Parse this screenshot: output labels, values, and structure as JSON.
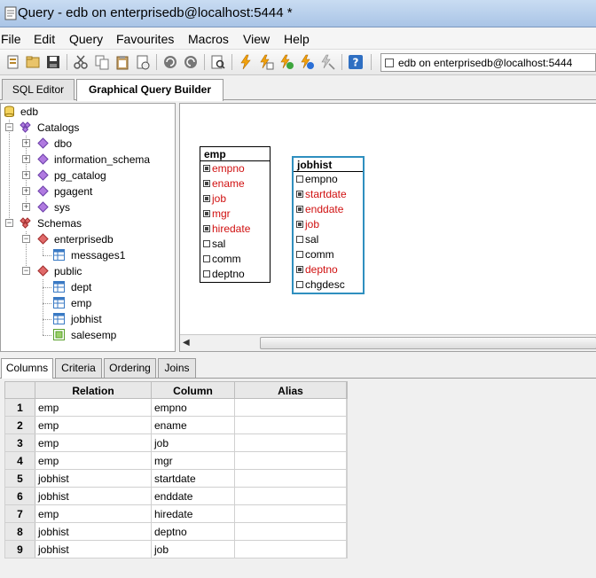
{
  "window": {
    "title": "Query - edb on enterprisedb@localhost:5444 *"
  },
  "menu": [
    "File",
    "Edit",
    "Query",
    "Favourites",
    "Macros",
    "View",
    "Help"
  ],
  "toolbar": {
    "connection": "edb on enterprisedb@localhost:5444",
    "icons": [
      "open-file-icon",
      "open-folder-icon",
      "save-icon",
      "cut-icon",
      "copy-icon",
      "paste-icon",
      "clear-icon",
      "undo-icon",
      "redo-icon",
      "find-icon",
      "execute-icon",
      "execute-to-file-icon",
      "explain-icon",
      "explain-analyze-icon",
      "cancel-icon",
      "help-icon"
    ]
  },
  "main_tabs": [
    "SQL Editor",
    "Graphical Query Builder"
  ],
  "tree": {
    "root": "edb",
    "catalogs_label": "Catalogs",
    "catalogs": [
      "dbo",
      "information_schema",
      "pg_catalog",
      "pgagent",
      "sys"
    ],
    "schemas_label": "Schemas",
    "enterprisedb_label": "enterprisedb",
    "enterprisedb_items": [
      "messages1"
    ],
    "public_label": "public",
    "public_items": [
      "dept",
      "emp",
      "jobhist",
      "salesemp"
    ]
  },
  "canvas": {
    "emp": {
      "name": "emp",
      "columns": [
        {
          "name": "empno",
          "checked": true
        },
        {
          "name": "ename",
          "checked": true
        },
        {
          "name": "job",
          "checked": true
        },
        {
          "name": "mgr",
          "checked": true
        },
        {
          "name": "hiredate",
          "checked": true
        },
        {
          "name": "sal",
          "checked": false
        },
        {
          "name": "comm",
          "checked": false
        },
        {
          "name": "deptno",
          "checked": false
        }
      ]
    },
    "jobhist": {
      "name": "jobhist",
      "columns": [
        {
          "name": "empno",
          "checked": false
        },
        {
          "name": "startdate",
          "checked": true
        },
        {
          "name": "enddate",
          "checked": true
        },
        {
          "name": "job",
          "checked": true
        },
        {
          "name": "sal",
          "checked": false
        },
        {
          "name": "comm",
          "checked": false
        },
        {
          "name": "deptno",
          "checked": true
        },
        {
          "name": "chgdesc",
          "checked": false
        }
      ]
    }
  },
  "bottom_tabs": [
    "Columns",
    "Criteria",
    "Ordering",
    "Joins"
  ],
  "grid": {
    "headers": [
      "Relation",
      "Column",
      "Alias"
    ],
    "rows": [
      {
        "num": "1",
        "relation": "emp",
        "column": "empno",
        "alias": ""
      },
      {
        "num": "2",
        "relation": "emp",
        "column": "ename",
        "alias": ""
      },
      {
        "num": "3",
        "relation": "emp",
        "column": "job",
        "alias": ""
      },
      {
        "num": "4",
        "relation": "emp",
        "column": "mgr",
        "alias": ""
      },
      {
        "num": "5",
        "relation": "jobhist",
        "column": "startdate",
        "alias": ""
      },
      {
        "num": "6",
        "relation": "jobhist",
        "column": "enddate",
        "alias": ""
      },
      {
        "num": "7",
        "relation": "emp",
        "column": "hiredate",
        "alias": ""
      },
      {
        "num": "8",
        "relation": "jobhist",
        "column": "deptno",
        "alias": ""
      },
      {
        "num": "9",
        "relation": "jobhist",
        "column": "job",
        "alias": ""
      }
    ]
  },
  "colors": {
    "selected_column": "#d01010",
    "active_table_border": "#2f8fbf"
  }
}
